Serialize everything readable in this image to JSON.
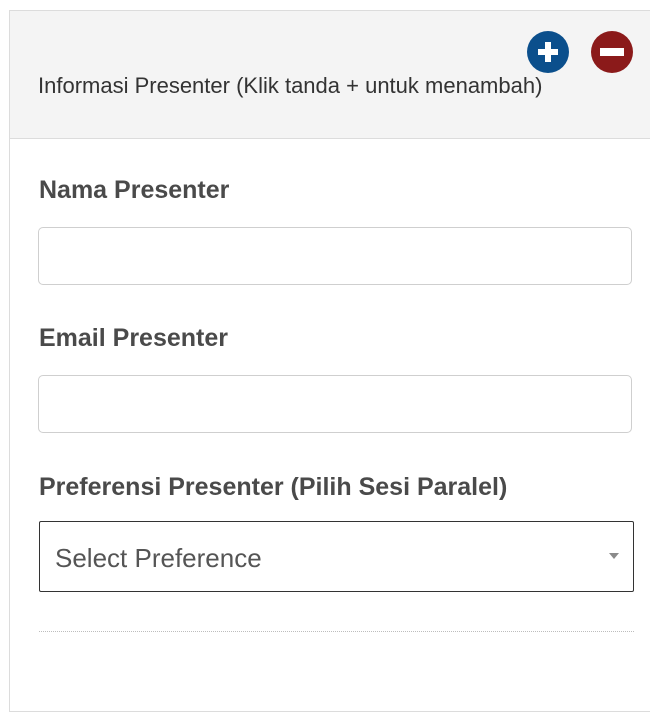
{
  "header": {
    "title": "Informasi Presenter (Klik tanda + untuk menambah)",
    "add_icon": "plus-circle-icon",
    "remove_icon": "minus-circle-icon",
    "add_color": "#0b4f8c",
    "remove_color": "#8b1a1a"
  },
  "form": {
    "name_label": "Nama Presenter",
    "name_value": "",
    "email_label": "Email Presenter",
    "email_value": "",
    "preference_label": "Preferensi Presenter (Pilih Sesi Paralel)",
    "preference_selected": "Select Preference"
  }
}
